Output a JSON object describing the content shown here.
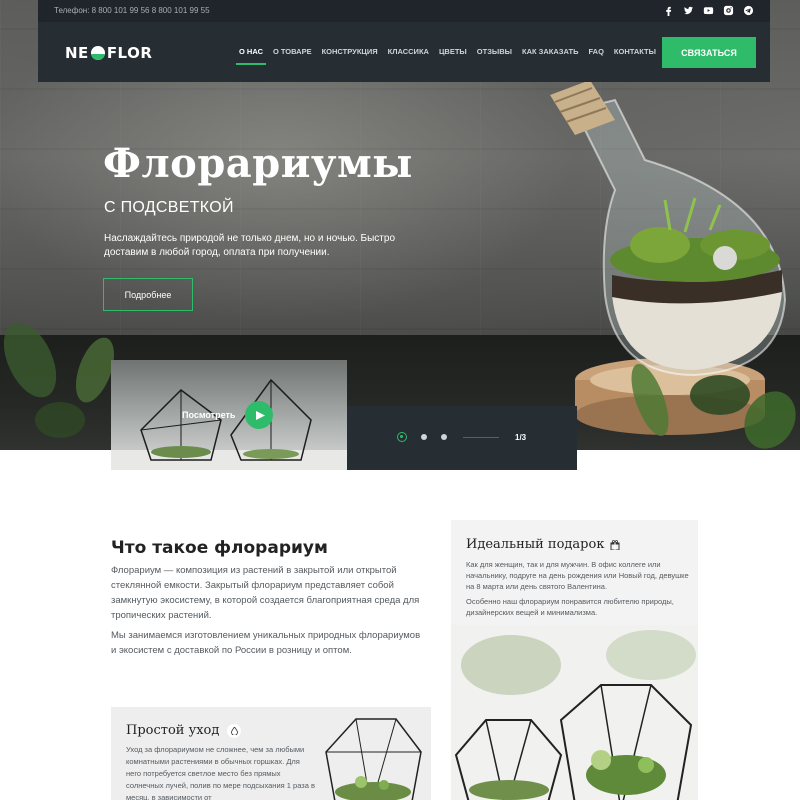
{
  "topbar": {
    "phone": "Телефон: 8 800 101 99 56    8 800 101 99 55",
    "socials": [
      "facebook-icon",
      "twitter-icon",
      "youtube-icon",
      "instagram-icon",
      "telegram-icon"
    ]
  },
  "navbar": {
    "logo_left": "NE",
    "logo_right": "FLOR",
    "items": [
      "О НАС",
      "О ТОВАРЕ",
      "КОНСТРУКЦИЯ",
      "КЛАССИКА",
      "ЦВЕТЫ",
      "ОТЗЫВЫ",
      "КАК ЗАКАЗАТЬ",
      "FAQ",
      "КОНТАКТЫ"
    ],
    "active_index": 0,
    "contact_button": "СВЯЗАТЬСЯ"
  },
  "hero": {
    "title": "Флорариумы",
    "subtitle": "С ПОДСВЕТКОЙ",
    "description": "Наслаждайтесь природой не только днем, но и ночью. Быстро доставим в любой город, оплата при получении.",
    "more_button": "Подробнее"
  },
  "video": {
    "watch_label": "Посмотреть"
  },
  "slider": {
    "current": 1,
    "total": 3,
    "counter": "1/3"
  },
  "about": {
    "title": "Что такое флорариум",
    "p1": "Флорариум — композиция из растений в закрытой или открытой стеклянной емкости. Закрытый флорариум представляет собой замкнутую экосистему, в которой создается благоприятная среда для тропических растений.",
    "p2": "Мы занимаемся изготовлением уникальных природных флорариумов и экосистем с доставкой по России в розницу и оптом."
  },
  "gift": {
    "title": "Идеальный подарок",
    "p1": "Как для женщин, так и для мужчин. В офис коллеге или начальнику, подруге на день рождения или Новый год, девушке на 8 марта или день святого Валентина.",
    "p2": "Особенно наш флорариум понравится любителю природы, дизайнерских вещей и минимализма."
  },
  "care": {
    "title": "Простой уход",
    "text": "Уход за флорариумом не сложнее, чем за любыми комнатными растениями в обычных горшках. Для него потребуется светлое место без прямых солнечных лучей, полив по мере подсыхания 1 раза в месяц, в зависимости от"
  },
  "colors": {
    "accent": "#2ebc6b",
    "nav_bg": "#262d33",
    "topbar_bg": "#1f252b"
  }
}
